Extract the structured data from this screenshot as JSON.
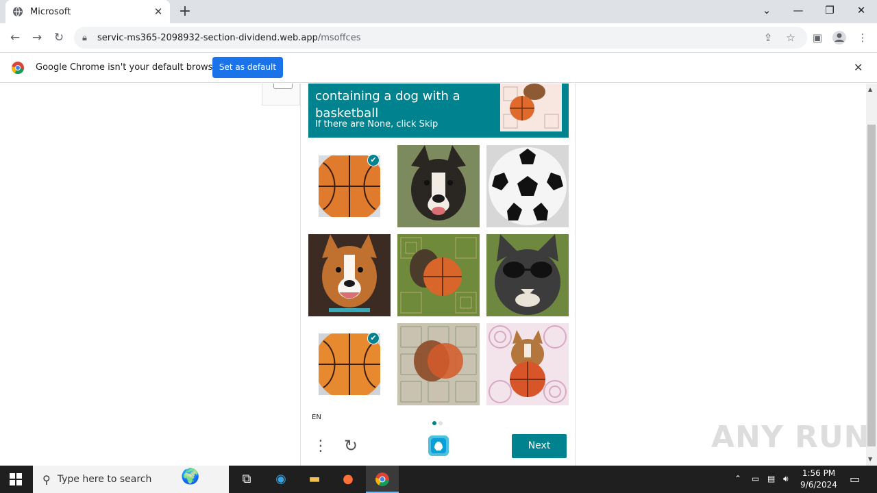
{
  "browser": {
    "tab_title": "Microsoft",
    "url_domain": "servic-ms365-2098932-section-dividend.web.app",
    "url_path": "/msoffces",
    "infobar_message": "Google Chrome isn't your default browser",
    "infobar_button": "Set as default"
  },
  "captcha": {
    "prompt_title": "containing a dog with a basketball",
    "prompt_subtitle": "If there are None, click Skip",
    "language": "EN",
    "next_label": "Next",
    "accent_color": "#00838f",
    "images": [
      {
        "subject": "basketball",
        "selected": true
      },
      {
        "subject": "dog",
        "selected": false
      },
      {
        "subject": "soccer-ball",
        "selected": false
      },
      {
        "subject": "dog",
        "selected": false
      },
      {
        "subject": "dog-with-basketball-distorted",
        "selected": false
      },
      {
        "subject": "cat-with-sunglasses",
        "selected": false
      },
      {
        "subject": "basketball",
        "selected": true
      },
      {
        "subject": "dog-with-basketball-distorted",
        "selected": false
      },
      {
        "subject": "dog-with-basketball-pattern",
        "selected": false
      }
    ]
  },
  "watermark": "ANY RUN",
  "taskbar": {
    "search_placeholder": "Type here to search",
    "time": "1:56 PM",
    "date": "9/6/2024"
  }
}
